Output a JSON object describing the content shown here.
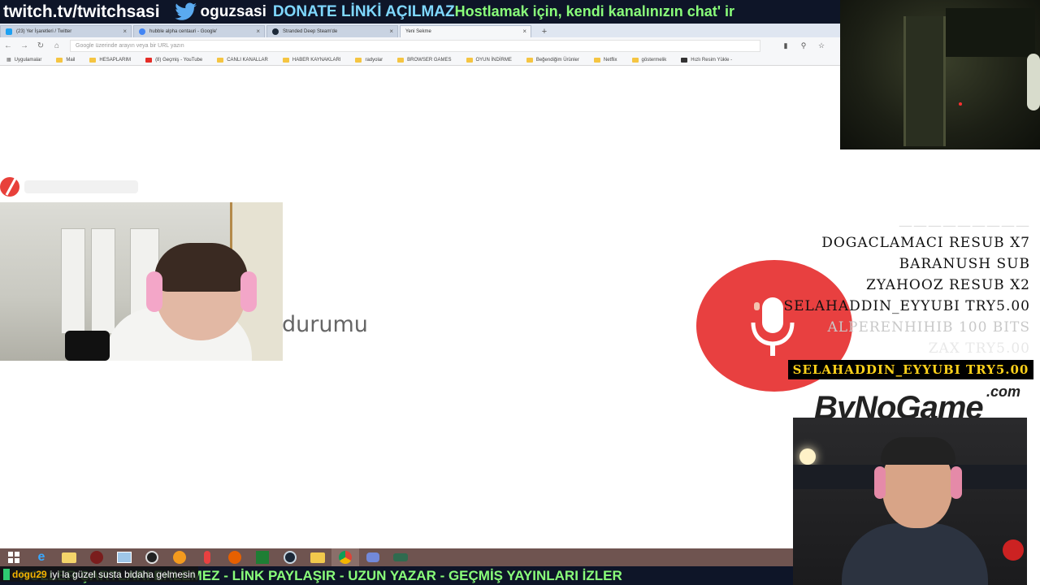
{
  "stream_banner": {
    "channel_url": "twitch.tv/twitchsasi",
    "twitter_handle": "oguzsasi",
    "donate_text": "DONATE LİNKİ AÇILMAZ",
    "message_text": "Hostlamak için, kendi kanalınızın chat' ir"
  },
  "browser": {
    "tabs": [
      {
        "label": "(23) Yer İşaretleri / Twitter",
        "favicon_color": "#1da1f2",
        "close": "×"
      },
      {
        "label": "hubble alpha centauri - Google'",
        "favicon_color": "#4285f4",
        "close": "×"
      },
      {
        "label": "Stranded Deep Steam'de",
        "favicon_color": "#1b2838",
        "close": "×"
      },
      {
        "label": "Yeni Sekme",
        "favicon_color": "#ffffff",
        "close": "×"
      }
    ],
    "new_tab_symbol": "+",
    "omnibox_placeholder": "Google üzerinde arayın veya bir URL yazın",
    "bookmarks": [
      "Uygulamalar",
      "Mail",
      "HESAPLARIM",
      "(8) Geçmiş - YouTube",
      "CANLI KANALLAR",
      "HABER KAYNAKLARI",
      "radyolar",
      "BROWSER GAMES",
      "OYUN İNDİRME",
      "Beğendiğim Ürünler",
      "Netflix",
      "göstermelik",
      "Hızlı Resim Yükle -"
    ]
  },
  "page": {
    "fragment_text": "durumu"
  },
  "alerts": {
    "events": [
      {
        "text": "DOGACLAMACI RESUB X7",
        "style": "normal"
      },
      {
        "text": "BARANUSH SUB",
        "style": "normal"
      },
      {
        "text": "ZYAHOOZ RESUB X2",
        "style": "normal"
      },
      {
        "text": "SELAHADDIN_EYYUBI TRY5.00",
        "style": "normal"
      },
      {
        "text": "ALPERENHIHIB 100 BITS",
        "style": "fade1"
      },
      {
        "text": "ZAX TRY5.00",
        "style": "fade2"
      }
    ],
    "latest": "SELAHADDIN_EYYUBI TRY5.00"
  },
  "sponsor": {
    "brand": "ByNoGame",
    "domain": ".com"
  },
  "chat": {
    "user": "dogu29",
    "message": "iyi la güzel susta bidaha gelmesin"
  },
  "bottom_ticker": {
    "text": "ROLLER  ŞARTLARI  EKLEMEZ - LİNK PAYLAŞIR - UZUN YAZAR - GEÇMİŞ YAYINLARI İZLER"
  },
  "taskbar": {
    "icons": [
      "windows-start",
      "internet-explorer",
      "file-explorer",
      "app-red",
      "photo-viewer",
      "obs",
      "orange-app",
      "microphone",
      "firefox",
      "excel",
      "steam",
      "folder",
      "chrome",
      "discord",
      "game-app"
    ]
  },
  "colors": {
    "banner_bg": "#0e1528",
    "banner_green": "#8aff7a",
    "banner_cyan": "#7fd8ff",
    "mic_red": "#e84040",
    "latest_gold": "#ffd21a",
    "taskbar": "#6f5450"
  }
}
